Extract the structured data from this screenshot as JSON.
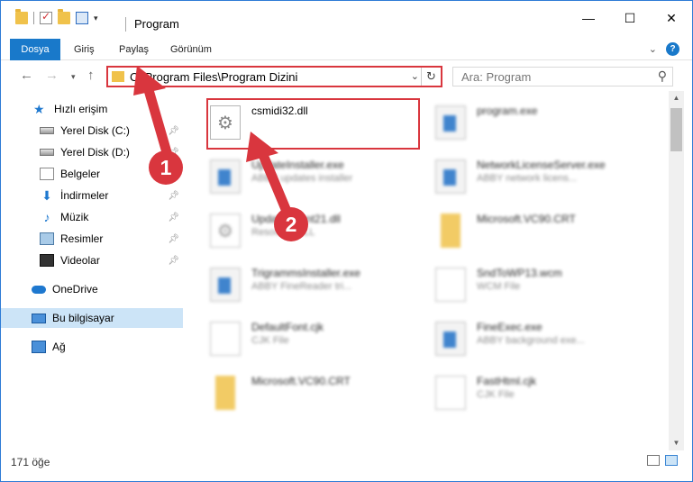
{
  "window": {
    "title": "Program",
    "controls": {
      "minimize": "—",
      "maximize": "☐",
      "close": "✕"
    }
  },
  "ribbon": {
    "tabs": [
      "Dosya",
      "Giriş",
      "Paylaş",
      "Görünüm"
    ]
  },
  "address": {
    "path": "C:\\Program Files\\Program Dizini",
    "search_placeholder": "Ara: Program"
  },
  "nav_pane": {
    "items": [
      {
        "label": "Hızlı erişim",
        "icon": "star-icon"
      },
      {
        "label": "Yerel Disk (C:)",
        "icon": "drive-icon",
        "pinned": true
      },
      {
        "label": "Yerel Disk (D:)",
        "icon": "drive-icon",
        "pinned": true
      },
      {
        "label": "Belgeler",
        "icon": "documents-icon",
        "pinned": true
      },
      {
        "label": "İndirmeler",
        "icon": "download-icon",
        "pinned": true
      },
      {
        "label": "Müzik",
        "icon": "music-icon",
        "pinned": true
      },
      {
        "label": "Resimler",
        "icon": "pictures-icon",
        "pinned": true
      },
      {
        "label": "Videolar",
        "icon": "videos-icon",
        "pinned": true
      },
      {
        "label": "OneDrive",
        "icon": "cloud-icon"
      },
      {
        "label": "Bu bilgisayar",
        "icon": "computer-icon",
        "selected": true
      },
      {
        "label": "Ağ",
        "icon": "network-icon"
      }
    ]
  },
  "files": [
    {
      "name": "csmidi32.dll",
      "desc": "",
      "icon": "dll-icon",
      "highlighted": true
    },
    {
      "name": "program.exe",
      "desc": "",
      "icon": "exe-icon"
    },
    {
      "name": "UpdateInstaller.exe",
      "desc": "ABBY updates installer",
      "icon": "exe-icon"
    },
    {
      "name": "NetworkLicenseServer.exe",
      "desc": "ABBY network licens...",
      "icon": "exe-icon"
    },
    {
      "name": "UpdateAgent21.dll",
      "desc": "Resource DLL",
      "icon": "dll-icon"
    },
    {
      "name": "Microsoft.VC90.CRT",
      "desc": "",
      "icon": "folder-icon"
    },
    {
      "name": "TrigrammsInstaller.exe",
      "desc": "ABBY FineReader tri...",
      "icon": "exe-icon"
    },
    {
      "name": "SndToWP13.wcm",
      "desc": "WCM File",
      "icon": "document-icon"
    },
    {
      "name": "DefaultFont.cjk",
      "desc": "CJK File",
      "icon": "document-icon"
    },
    {
      "name": "FineExec.exe",
      "desc": "ABBY background exe...",
      "icon": "exe-icon"
    },
    {
      "name": "Microsoft.VC90.CRT",
      "desc": "",
      "icon": "folder-icon"
    },
    {
      "name": "FastHtml.cjk",
      "desc": "CJK File",
      "icon": "document-icon"
    }
  ],
  "status": {
    "item_count": "171 öğe"
  },
  "annotations": {
    "step1": "1",
    "step2": "2",
    "accent_color": "#d9363e"
  }
}
